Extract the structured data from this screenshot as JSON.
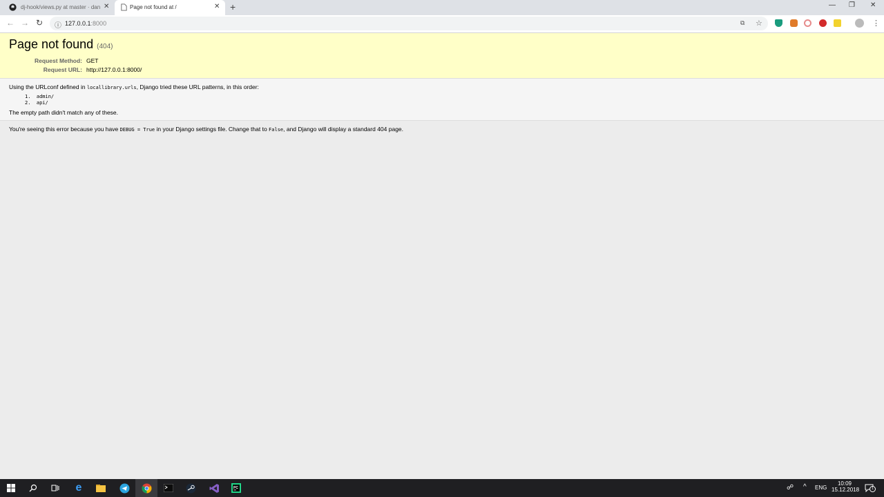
{
  "browser": {
    "tabs": [
      {
        "title": "dj-hook/views.py at master · dan",
        "favicon": "github-icon"
      },
      {
        "title": "Page not found at /",
        "favicon": "page-icon"
      }
    ],
    "address": {
      "host": "127.0.0.1",
      "port": ":8000"
    }
  },
  "page": {
    "title": "Page not found",
    "status_code": "(404)",
    "request_method_label": "Request Method:",
    "request_method": "GET",
    "request_url_label": "Request URL:",
    "request_url": "http://127.0.0.1:8000/",
    "urlconf_prefix": "Using the URLconf defined in ",
    "urlconf_name": "locallibrary.urls",
    "urlconf_suffix": ", Django tried these URL patterns, in this order:",
    "patterns": [
      "admin/",
      "api/"
    ],
    "no_match": "The empty path didn't match any of these.",
    "debug_prefix": "You're seeing this error because you have ",
    "debug_code": "DEBUG = True",
    "debug_middle": " in your Django settings file. Change that to ",
    "debug_false": "False",
    "debug_suffix": ", and Django will display a standard 404 page."
  },
  "taskbar": {
    "lang": "ENG",
    "time": "10:09",
    "date": "15.12.2018",
    "notifications": "1"
  },
  "colors": {
    "summary_bg": "#ffffc8",
    "info_bg": "#f5f5f5",
    "taskbar_bg": "#1f1f22"
  }
}
